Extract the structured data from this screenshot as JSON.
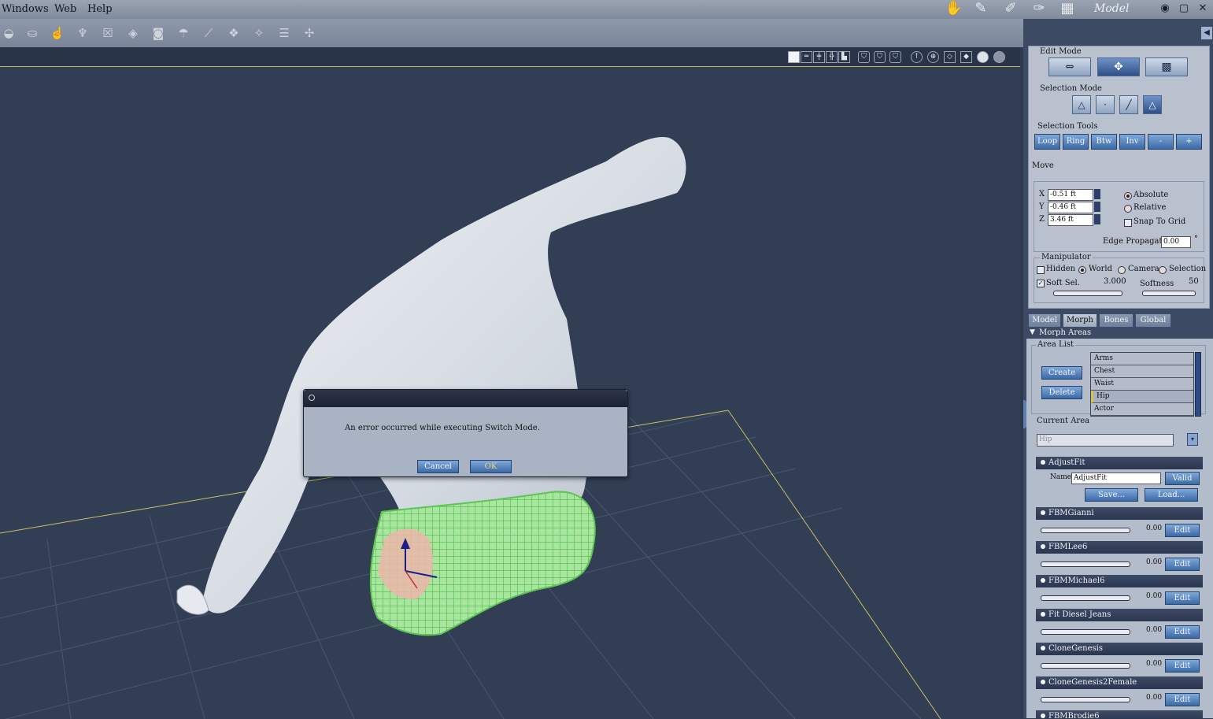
{
  "menu": {
    "items": [
      "Windows",
      "Web",
      "Help"
    ]
  },
  "room": {
    "mode_label": "Model"
  },
  "dialog": {
    "message": "An error occurred while executing Switch Mode.",
    "cancel_label": "Cancel",
    "ok_label": "OK"
  },
  "panel": {
    "edit_mode_label": "Edit Mode",
    "selection_mode_label": "Selection Mode",
    "selection_tools_label": "Selection Tools",
    "selection_tools": [
      "Loop",
      "Ring",
      "Btw",
      "Inv",
      "-",
      "+"
    ],
    "move_label": "Move",
    "x_label": "X",
    "x_value": "-0.51 ft",
    "y_label": "Y",
    "y_value": "-0.46 ft",
    "z_label": "Z",
    "z_value": "3.46 ft",
    "absolute_label": "Absolute",
    "relative_label": "Relative",
    "snap_label": "Snap To Grid",
    "edge_prop_label": "Edge Propagation",
    "edge_prop_value": "0.00",
    "degree_symbol": "°",
    "manipulator_label": "Manipulator",
    "hidden_label": "Hidden",
    "world_label": "World",
    "camera_label": "Camera",
    "selection_label": "Selection",
    "soft_sel_label": "Soft Sel.",
    "soft_sel_value": "3.000",
    "softness_label": "Softness",
    "softness_value": "50",
    "tabs": [
      "Model",
      "Morph",
      "Bones",
      "Global"
    ],
    "morph_areas_label": "Morph Areas",
    "area_list_label": "Area List",
    "create_label": "Create",
    "delete_label": "Delete",
    "areas": [
      "Arms",
      "Chest",
      "Waist",
      "Hip",
      "Actor"
    ],
    "current_area_label": "Current Area",
    "current_area_value": "Hip",
    "adjustfit": {
      "title": "AdjustFit",
      "name_label": "Name:",
      "name_value": "AdjustFit",
      "valid_label": "Valid",
      "save_label": "Save...",
      "load_label": "Load..."
    },
    "edit_label": "Edit",
    "morphs": [
      {
        "name": "FBMGianni",
        "value": "0.00"
      },
      {
        "name": "FBMLee6",
        "value": "0.00"
      },
      {
        "name": "FBMMichael6",
        "value": "0.00"
      },
      {
        "name": "Fit Diesel Jeans",
        "value": "0.00"
      },
      {
        "name": "CloneGenesis",
        "value": "0.00"
      },
      {
        "name": "CloneGenesis2Female",
        "value": "0.00"
      },
      {
        "name": "FBMBrodie6",
        "value": ""
      }
    ]
  },
  "colors": {
    "viewport_bg": "#323e54",
    "mesh": "#dde2e8",
    "wire": "#7ddc6f",
    "accent_button": "#3c6aa6"
  }
}
